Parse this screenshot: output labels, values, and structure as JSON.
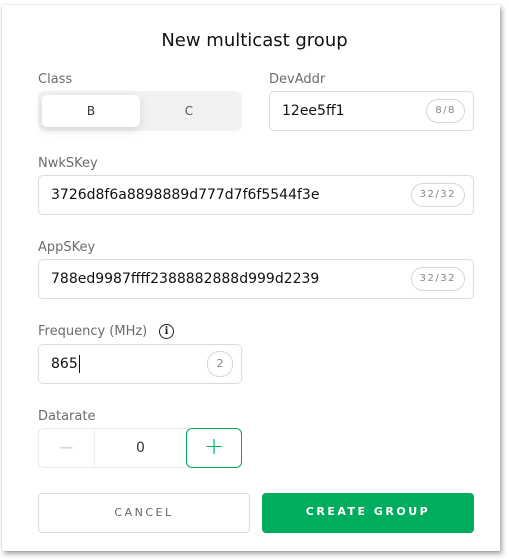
{
  "dialog": {
    "title": "New multicast group"
  },
  "class": {
    "label": "Class",
    "options": [
      "B",
      "C"
    ],
    "selected": "B"
  },
  "devaddr": {
    "label": "DevAddr",
    "value": "12ee5ff1",
    "counter": "8/8"
  },
  "nwkskey": {
    "label": "NwkSKey",
    "value": "3726d8f6a8898889d777d7f6f5544f3e",
    "counter": "32/32"
  },
  "appskey": {
    "label": "AppSKey",
    "value": "788ed9987ffff2388882888d999d2239",
    "counter": "32/32"
  },
  "frequency": {
    "label": "Frequency (MHz)",
    "info_icon": "info-icon",
    "value": "865",
    "counter": "2"
  },
  "datarate": {
    "label": "Datarate",
    "value": "0",
    "minus": "−",
    "plus": "+"
  },
  "actions": {
    "cancel": "CANCEL",
    "create": "CREATE GROUP"
  },
  "colors": {
    "accent": "#00ad5c"
  }
}
